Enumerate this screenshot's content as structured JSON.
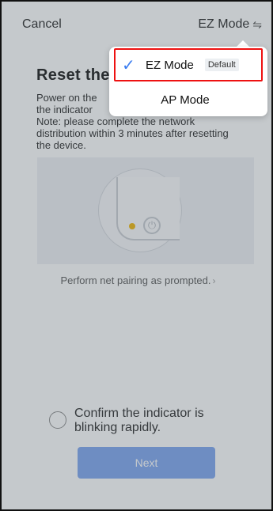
{
  "topbar": {
    "cancel_label": "Cancel",
    "mode_label": "EZ Mode",
    "swap_icon": "swap-icon"
  },
  "page": {
    "title": "Reset the",
    "instructions_line1": "Power on the",
    "instructions_line2": "the indicator",
    "instructions_line3": "Note: please complete the network distribution within 3 minutes after resetting the device.",
    "pairing_link": "Perform net pairing as prompted.",
    "confirm_text": "Confirm the indicator is blinking rapidly.",
    "next_label": "Next"
  },
  "dropdown": {
    "items": [
      {
        "label": "EZ Mode",
        "badge": "Default",
        "selected": true
      },
      {
        "label": "AP Mode",
        "selected": false
      }
    ],
    "highlight_color": "#ee1111",
    "check_color": "#3a7cf0"
  },
  "colors": {
    "next_button": "#7aa3f0",
    "indicator_dot": "#f0b400"
  }
}
